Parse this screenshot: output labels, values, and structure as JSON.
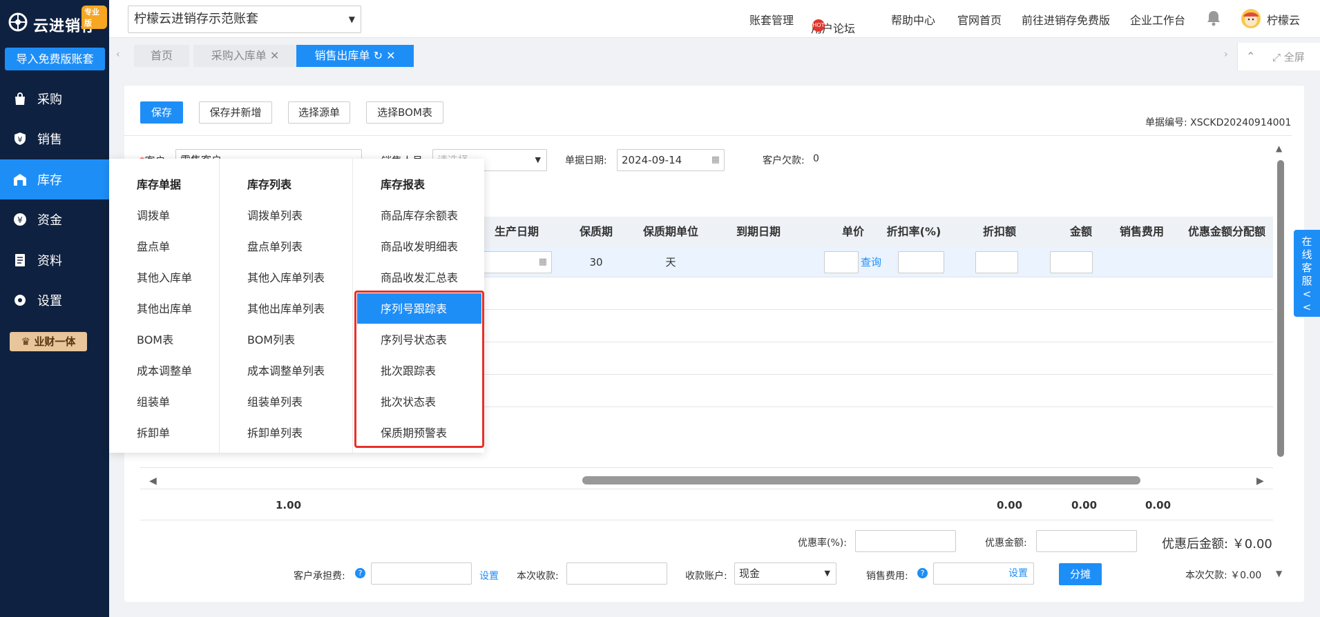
{
  "sidebar": {
    "logo_text": "云进销存",
    "logo_badge": "专业版",
    "import_button": "导入免费版账套",
    "items": [
      {
        "label": "采购",
        "icon": "bag-icon"
      },
      {
        "label": "销售",
        "icon": "shield-yen-icon"
      },
      {
        "label": "库存",
        "icon": "warehouse-icon"
      },
      {
        "label": "资金",
        "icon": "yen-circle-icon"
      },
      {
        "label": "资料",
        "icon": "document-icon"
      },
      {
        "label": "设置",
        "icon": "gear-icon"
      }
    ],
    "yc_button": "业财一体"
  },
  "topbar": {
    "account": "柠檬云进销存示范账套",
    "links": [
      "账套管理",
      "用户论坛",
      "帮助中心",
      "官网首页",
      "前往进销存免费版",
      "企业工作台"
    ],
    "hot": "HOT",
    "user": "柠檬云"
  },
  "tabs": {
    "items": [
      "首页",
      "采购入库单",
      "销售出库单"
    ],
    "fullscreen": "全屏"
  },
  "toolbar": {
    "save": "保存",
    "save_new": "保存并新增",
    "select_source": "选择源单",
    "select_bom": "选择BOM表",
    "doc_no": "单据编号: XSCKD20240914001"
  },
  "form": {
    "customer_label": "客户:",
    "customer_value": "零售客户",
    "sales_label": "销售人员:",
    "sales_placeholder": "请选择",
    "date_label": "单据日期:",
    "date_value": "2024-09-14",
    "debt_label": "客户欠款:",
    "debt_value": "0"
  },
  "grid": {
    "headers": [
      "生产日期",
      "保质期",
      "保质期单位",
      "到期日期",
      "单价",
      "折扣率(%)",
      "折扣额",
      "金额",
      "销售费用",
      "优惠金额分配额"
    ],
    "row": {
      "shelf_life": "30",
      "unit": "天",
      "query": "查询"
    },
    "totals": [
      "1.00",
      "0.00",
      "0.00",
      "0.00"
    ]
  },
  "footer": {
    "discount_rate_label": "优惠率(%):",
    "discount_amount_label": "优惠金额:",
    "after_discount": "优惠后金额:  ￥0.00",
    "customer_fee_label": "客户承担费:",
    "set": "设置",
    "receipt_label": "本次收款:",
    "account_label": "收款账户:",
    "account_value": "现金",
    "sales_fee_label": "销售费用:",
    "split": "分摊",
    "debt_this": "本次欠款: ￥0.00"
  },
  "dropdown": {
    "col1": {
      "title": "库存单据",
      "items": [
        "调拨单",
        "盘点单",
        "其他入库单",
        "其他出库单",
        "BOM表",
        "成本调整单",
        "组装单",
        "拆卸单"
      ]
    },
    "col2": {
      "title": "库存列表",
      "items": [
        "调拨单列表",
        "盘点单列表",
        "其他入库单列表",
        "其他出库单列表",
        "BOM列表",
        "成本调整单列表",
        "组装单列表",
        "拆卸单列表"
      ]
    },
    "col3": {
      "title": "库存报表",
      "items": [
        "商品库存余额表",
        "商品收发明细表",
        "商品收发汇总表",
        "序列号跟踪表",
        "序列号状态表",
        "批次跟踪表",
        "批次状态表",
        "保质期预警表"
      ]
    }
  },
  "kefu": {
    "label": "在线客服<<"
  },
  "colors": {
    "primary": "#1e8ef7",
    "sidebar": "#0f2140",
    "highlight_border": "#e8302a"
  }
}
